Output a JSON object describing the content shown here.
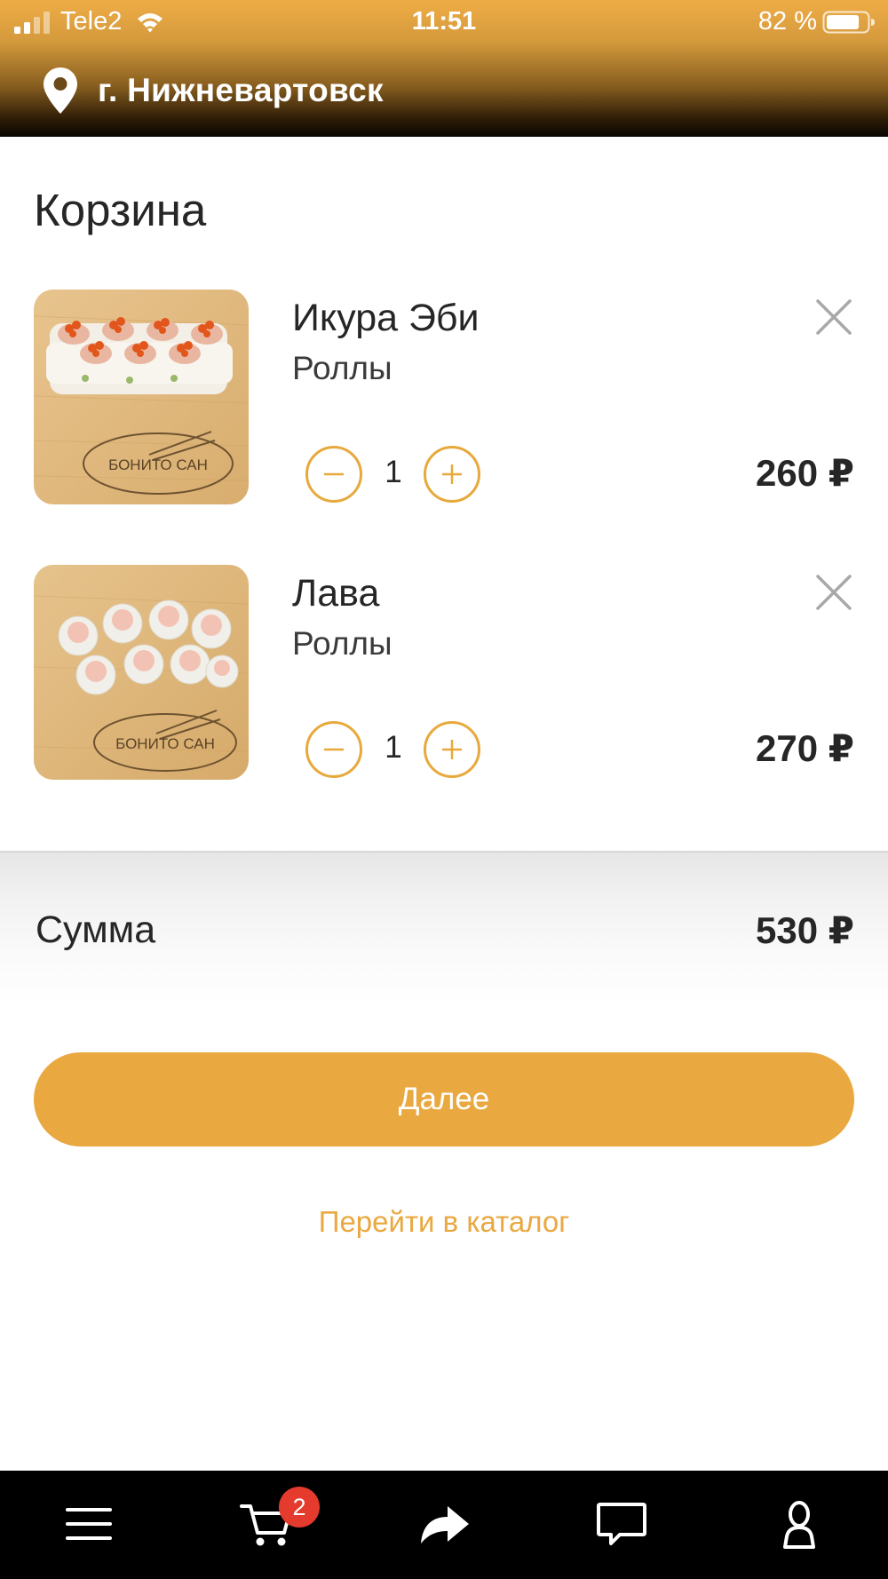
{
  "colors": {
    "accent": "#e9a840",
    "badge": "#e53a2e",
    "tabbar": "#000000",
    "text": "#262626"
  },
  "statusbar": {
    "carrier": "Tele2",
    "time": "11:51",
    "battery": "82 %",
    "battery_level": 0.82
  },
  "header": {
    "city": "г. Нижневартовск",
    "icon": "location-pin-icon"
  },
  "page": {
    "title": "Корзина"
  },
  "cart": {
    "items": [
      {
        "name": "Икура Эби",
        "category": "Роллы",
        "quantity": "1",
        "price": "260 ₽",
        "logo_text": "БОНИТО САН"
      },
      {
        "name": "Лава",
        "category": "Роллы",
        "quantity": "1",
        "price": "270 ₽",
        "logo_text": "БОНИТО САН"
      }
    ]
  },
  "summary": {
    "label": "Сумма",
    "value": "530 ₽"
  },
  "actions": {
    "next": "Далее",
    "catalog": "Перейти в каталог"
  },
  "tabbar": {
    "items": [
      {
        "icon": "menu-icon"
      },
      {
        "icon": "cart-icon",
        "badge": "2"
      },
      {
        "icon": "share-icon"
      },
      {
        "icon": "chat-icon"
      },
      {
        "icon": "profile-icon"
      }
    ]
  }
}
